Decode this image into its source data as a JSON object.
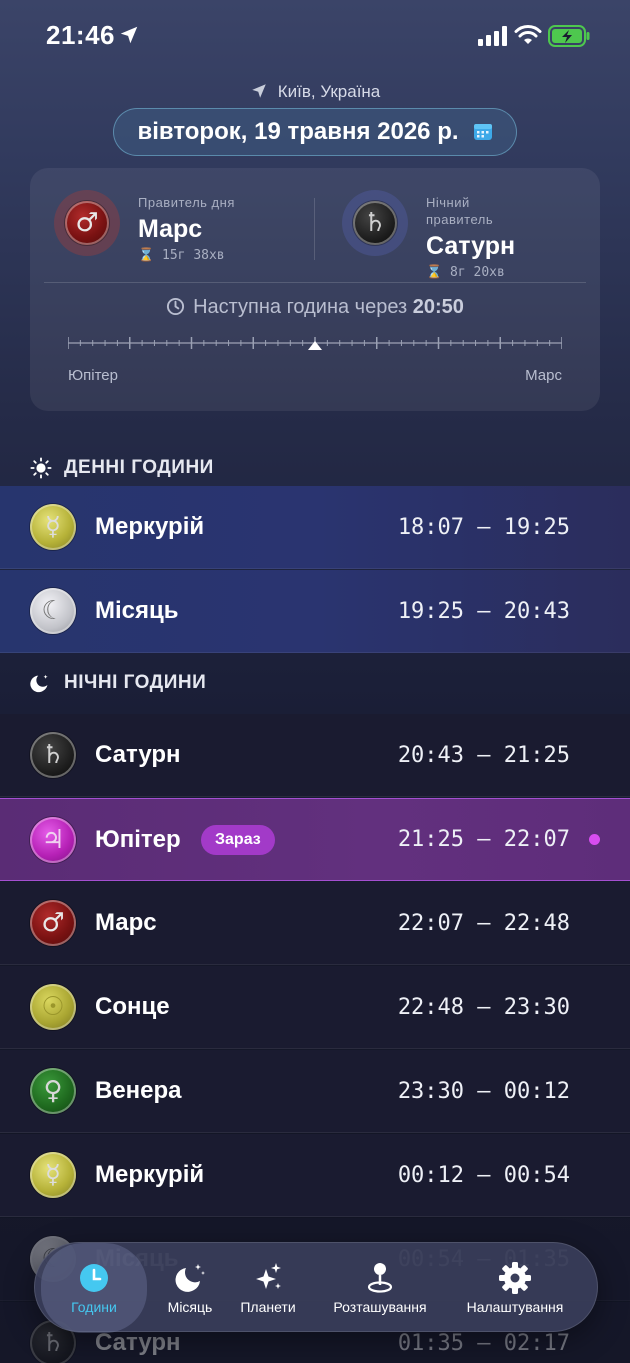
{
  "status_bar": {
    "time": "21:46"
  },
  "header": {
    "location": "Київ, Україна",
    "date": "вівторок, 19 травня 2026 р."
  },
  "rulers": {
    "day": {
      "label": "Правитель дня",
      "planet": "Марс",
      "symbol": "♂",
      "duration": "15г 38хв"
    },
    "night": {
      "label_line1": "Нічний",
      "label_line2": "правитель",
      "planet": "Сатурн",
      "symbol": "♄",
      "duration": "8г 20хв"
    },
    "next_hour_prefix": "Наступна година через",
    "next_hour_time": "20:50",
    "timeline": {
      "left_label": "Юпітер",
      "right_label": "Марс",
      "progress": 0.5
    }
  },
  "sections": {
    "day_title": "ДЕННІ ГОДИНИ",
    "night_title": "НІЧНІ ГОДИНИ"
  },
  "day_hours": [
    {
      "planet": "Меркурій",
      "symbol": "☿",
      "time": "18:07 – 19:25",
      "style": "o-mercury"
    },
    {
      "planet": "Місяць",
      "symbol": "☾",
      "time": "19:25 – 20:43",
      "style": "o-moon"
    }
  ],
  "night_hours": [
    {
      "planet": "Сатурн",
      "symbol": "♄",
      "time": "20:43 – 21:25",
      "style": "o-saturn"
    },
    {
      "planet": "Юпітер",
      "symbol": "♃",
      "time": "21:25 – 22:07",
      "style": "o-jupiter",
      "badge": "Зараз",
      "active": true
    },
    {
      "planet": "Марс",
      "symbol": "♂",
      "time": "22:07 – 22:48",
      "style": "o-mars"
    },
    {
      "planet": "Сонце",
      "symbol": "☉",
      "time": "22:48 – 23:30",
      "style": "o-sun"
    },
    {
      "planet": "Венера",
      "symbol": "♀",
      "time": "23:30 – 00:12",
      "style": "o-venus"
    },
    {
      "planet": "Меркурій",
      "symbol": "☿",
      "time": "00:12 – 00:54",
      "style": "o-mercury"
    },
    {
      "planet": "Місяць",
      "symbol": "☾",
      "time": "00:54 – 01:35",
      "style": "o-moon"
    },
    {
      "planet": "Сатурн",
      "symbol": "♄",
      "time": "01:35 – 02:17",
      "style": "o-saturn"
    }
  ],
  "tab_bar": {
    "tabs": [
      {
        "label": "Години",
        "icon": "clock-icon",
        "active": true
      },
      {
        "label": "Місяць",
        "icon": "moon-stars-icon"
      },
      {
        "label": "Планети",
        "icon": "sparkles-icon"
      },
      {
        "label": "Розташування",
        "icon": "map-pin-icon"
      },
      {
        "label": "Налаштування",
        "icon": "gear-icon"
      }
    ]
  },
  "colors": {
    "accent": "#45c8f0",
    "active_row": "#62307e",
    "badge": "#a23ac8",
    "now_dot": "#d84df0"
  }
}
